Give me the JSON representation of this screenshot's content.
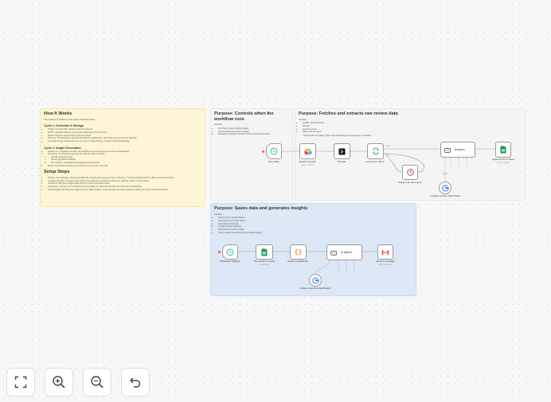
{
  "how_it_works": {
    "title": "How It Works",
    "intro": "The workflow is divided into two main automated cycles:",
    "cycle1_title": "Cycle 1: Collection & Storage",
    "cycle1_items": [
      "Trigger: The Run Daily schedule starts the process.",
      "Fetch: It searches Bluesky for any post containing new review links.",
      "Extract: Decodes raw the data to pull out content.",
      "Structure: The AI Analyzer (Gemini) identifies the specific date, star rating, and text from the raw data.",
      "Log: Each review is appended as a new row in Google Sheets, creating a historical database."
    ],
    "cycle2_title": "Cycle 2: Insight Generation",
    "cycle2_items": [
      "Analyze: On a separate schedule, the workflow retrieves all stored rows from Google Sheets.",
      "Summarize: An AI Agent processes the collective data to identify:",
      "Overall sentiment trends.",
      "Recurring positive feedback.",
      "Top customer complaints and suggested improvements.",
      "Report: A formatted summary is sent directly to your inbox via Gmail."
    ],
    "setup_title": "Setup Steps",
    "setup_items": [
      "Prepare your Database: Connect your Bluesky account and ensure you have a field (e.g., \"Links\") populated with the URLs you want to monitor.",
      "Configure Storage: Connect Google Sheets and select the spreadsheet where you want the reviews to be archived.",
      "Activate AI: Add your Google Gemini API key to the Chat Model nodes.",
      "Set Delivery: Connect your Gmail account and update the \"Send to\" field with your preferred email address.",
      "Timing: Adjust both Schedule Triggers (one for daily scraping, one for periodic summary reports) to match your team's reporting cadence."
    ]
  },
  "controls_note": {
    "title": "Purpose: Controls when the workflow runs",
    "includes": "Includes:",
    "items": [
      "Run Daily (review scraping trigger)",
      "Scheduled Review Analysis Trigger",
      "Manages automated execution without manual intervention"
    ]
  },
  "fetch_note": {
    "title": "Purpose: Fetches and extracts raw review data",
    "includes": "Includes:",
    "items": [
      "Airtable Search Records",
      "Decode",
      "Loop Over Items",
      "Delay until next cycle"
    ],
    "desc": "Responsible for pulling review links and safely processing them in batches."
  },
  "saves_note": {
    "title": "Purpose: Saves data and generates insights",
    "includes": "Includes:",
    "items": [
      "Append row in Google Sheets",
      "Get row(s) from Google Sheets",
      "Code (data structuring)",
      "AI Agent (review analysis)",
      "Gmail (send summary email)",
      "Stores reviews and delivers AI-generated insights"
    ]
  },
  "nodes": {
    "run_daily": "Run Daily",
    "search_records": "Search records",
    "search_records_sub": "search: airtable",
    "decode": "Decode",
    "loop_over_items": "Loop Over Items",
    "loop_done": "done",
    "loop_loop": "loop",
    "delay": "Delay until next cycle",
    "analyzer": "Analyzer",
    "gemini1": "Google Gemini Chat Model",
    "model_label": "Model",
    "append_row": "Append row in sheet",
    "append_row_sub": "append: sheet",
    "schedule_trigger1": "Schedule Trigger1",
    "get_rows": "Get row(s) in sheet",
    "get_rows_sub": "read: sheet",
    "code": "Code in JavaScript",
    "ai_agent": "AI Agent1",
    "send_message": "Send a message",
    "send_message_sub": "send: message",
    "gemini2": "Google Gemini Chat Model1"
  },
  "controls": {
    "fit": "fit-view-icon",
    "zoom_in": "zoom-in-icon",
    "zoom_out": "zoom-out-icon",
    "reset": "undo-icon"
  },
  "colors": {
    "note_yellow": "#fdf5d3",
    "note_blue": "#dce8f5",
    "trigger_green": "#35b88a",
    "n8n_red": "#ff6d5a",
    "sheets_green": "#0f9d58",
    "loop_green": "#3fa37a"
  }
}
